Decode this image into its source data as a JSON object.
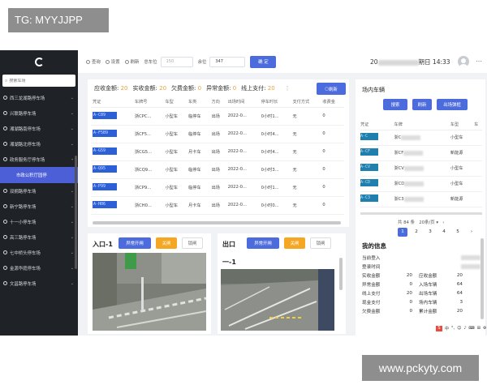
{
  "watermark_top": "TG: MYYJJPP",
  "watermark_bottom": "www.pckyty.com",
  "topbar": {
    "query": "查询",
    "settings": "设置",
    "refresh": "刷新",
    "total_spots_label": "总车位",
    "total_spots_placeholder": "150",
    "remaining_label": "余位",
    "remaining_value": "347",
    "confirm": "确 定",
    "date_prefix": "20",
    "date_suffix": "期日 14:33"
  },
  "search_placeholder": "搜索车场",
  "sidebar": {
    "items": [
      "西三龙湖路停车场",
      "兴联路停车场",
      "湘湖路南停车场",
      "湘湖路北停车场",
      "政务服务厅停车场",
      "市政公积厅园停",
      "双拥路停车场",
      "新宁路停车场",
      "十一小停车场",
      "高三路停车场",
      "七中桥头停车场",
      "金源华庭停车场",
      "文昌路停车场"
    ]
  },
  "stats": {
    "receivable": "应收金额:",
    "receivable_v": "20",
    "actual": "实收金额:",
    "actual_v": "20",
    "owed": "欠费金额:",
    "owed_v": "0",
    "abnormal": "异常金额:",
    "abnormal_v": "0",
    "online": "线上支付:",
    "online_v": "20",
    "more": "⋮",
    "refresh": "刷新"
  },
  "records": {
    "headers": [
      "凭证",
      "车牌号",
      "车型",
      "车类",
      "方向",
      "出场时间",
      "停车时长",
      "支付方式",
      "收费金"
    ],
    "rows": [
      [
        "A-C89",
        "浙CPC...",
        "小型车",
        "临停车",
        "出场",
        "2022-0...",
        "0小时1...",
        "无",
        "0"
      ],
      [
        "A-F5B9",
        "浙CF5...",
        "小型车",
        "临停车",
        "出场",
        "2022-0...",
        "0小时4...",
        "无",
        "0"
      ],
      [
        "A-G59",
        "浙CG5...",
        "小型车",
        "月卡车",
        "出场",
        "2022-0...",
        "0小时4...",
        "无",
        "0"
      ],
      [
        "A-Q95",
        "浙CQ9...",
        "小型车",
        "临停车",
        "出场",
        "2022-0...",
        "0小时3...",
        "无",
        "0"
      ],
      [
        "A-P99",
        "浙CP9...",
        "小型车",
        "临停车",
        "出场",
        "2022-0...",
        "0小时1...",
        "无",
        "0"
      ],
      [
        "A-H06",
        "浙CH0...",
        "小型车",
        "月卡车",
        "出场",
        "2022-0...",
        "0小时0...",
        "无",
        "0"
      ]
    ]
  },
  "entrance": {
    "title": "入口-1",
    "open": "异常开闸",
    "close": "关闸",
    "lock": "锁闸"
  },
  "exit": {
    "title": "出口",
    "open": "异常开闸",
    "close": "关闸",
    "lock": "锁闸",
    "sub": "一-1"
  },
  "inpark": {
    "title": "场内车辆",
    "search": "搜索",
    "refresh": "刷新",
    "exit_export": "出场弹框",
    "headers": [
      "凭证",
      "车牌",
      "车型",
      "车"
    ],
    "rows": [
      [
        "A-C",
        "浙C",
        "小型车"
      ],
      [
        "A-CF",
        "浙CF",
        "新能源"
      ],
      [
        "A-CV",
        "浙CV",
        "小型车"
      ],
      [
        "A-CD",
        "浙CD",
        "小型车"
      ],
      [
        "A-C3",
        "浙C3",
        "新能源"
      ]
    ],
    "total": "共 84 条",
    "per_page": "20条/页",
    "pages": [
      "1",
      "2",
      "3",
      "4",
      "5"
    ]
  },
  "myinfo": {
    "title": "我的信息",
    "rows": [
      {
        "k": "当前登入",
        "v": "",
        "k2": "",
        "v2": ""
      },
      {
        "k": "登录时间",
        "v": "",
        "k2": "",
        "v2": ""
      },
      {
        "k": "实收金额",
        "v": "20",
        "k2": "应收金额",
        "v2": "20"
      },
      {
        "k": "异常金额",
        "v": "0",
        "k2": "入场车辆",
        "v2": "64"
      },
      {
        "k": "线上支付",
        "v": "20",
        "k2": "出场车辆",
        "v2": "64"
      },
      {
        "k": "现金支付",
        "v": "0",
        "k2": "场内车辆",
        "v2": "3"
      },
      {
        "k": "欠费金额",
        "v": "0",
        "k2": "累计金额",
        "v2": "20"
      }
    ]
  },
  "tray": [
    "S",
    "中",
    "°,",
    "☺",
    "♪",
    "⌨",
    "⊞",
    "⚙"
  ]
}
